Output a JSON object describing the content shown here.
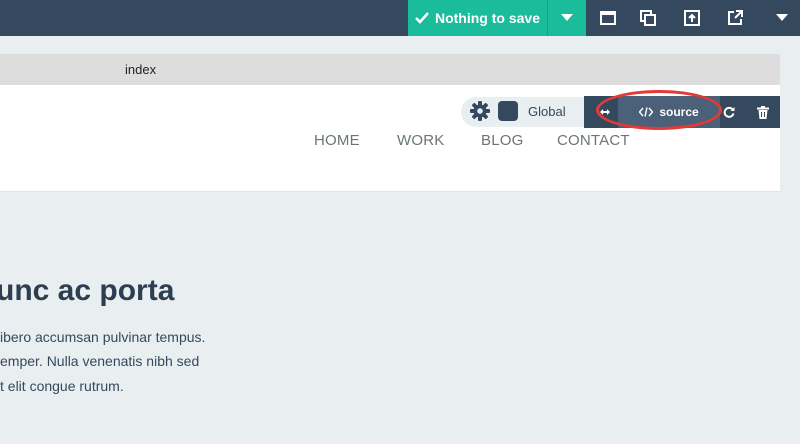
{
  "toolbar": {
    "save_label": "Nothing to save",
    "icons": [
      "check-icon",
      "caret-down-icon",
      "window-icon",
      "duplicate-icon",
      "upload-icon",
      "external-link-icon",
      "menu-caret-icon"
    ]
  },
  "tabs": {
    "active_label": "index"
  },
  "block_toolbar": {
    "global_label": "Global",
    "source_label": "source"
  },
  "nav": {
    "items": [
      "HOME",
      "WORK",
      "BLOG",
      "CONTACT"
    ]
  },
  "content": {
    "heading": "unc ac porta",
    "lines": [
      "ibero accumsan pulvinar tempus.",
      "emper. Nulla venenatis nibh sed",
      "t elit congue rutrum."
    ]
  },
  "colors": {
    "topbar": "#34495e",
    "accent": "#1abc9c",
    "highlight": "#e53935"
  }
}
